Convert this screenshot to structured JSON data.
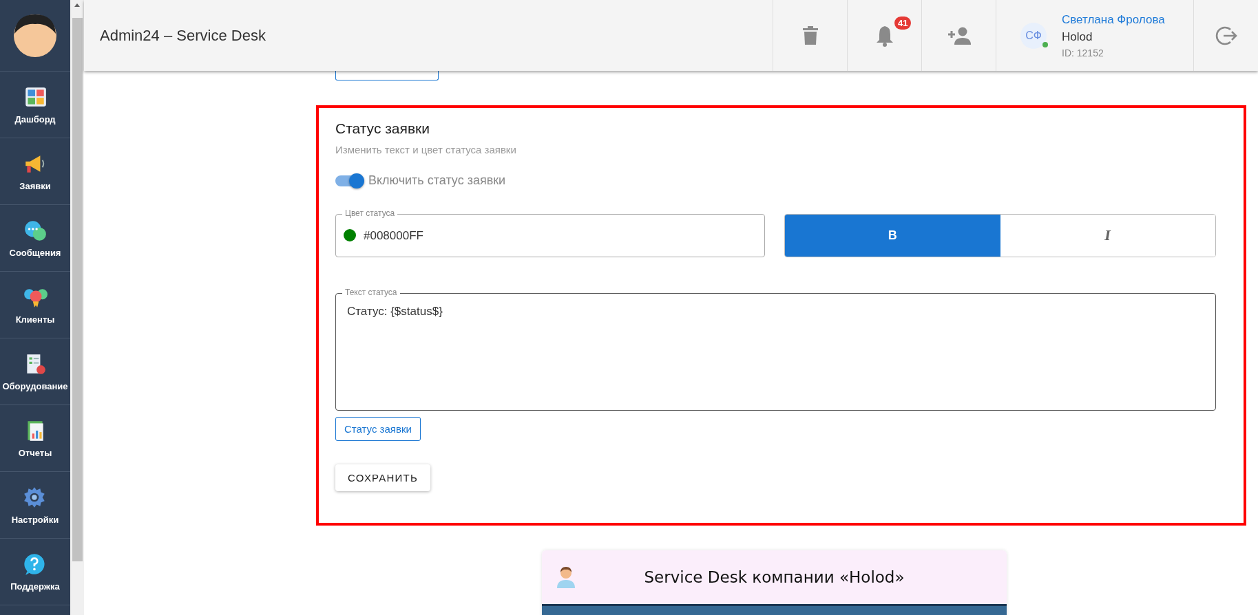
{
  "sidebar": {
    "items": [
      {
        "label": "Дашборд"
      },
      {
        "label": "Заявки"
      },
      {
        "label": "Сообщения"
      },
      {
        "label": "Клиенты"
      },
      {
        "label": "Оборудование"
      },
      {
        "label": "Отчеты"
      },
      {
        "label": "Настройки"
      },
      {
        "label": "Поддержка"
      }
    ]
  },
  "header": {
    "title": "Admin24 – Service Desk",
    "notifications": "41",
    "user": {
      "initials": "СФ",
      "name": "Светлана Фролова",
      "company": "Holod",
      "id": "ID: 12152",
      "online": true
    }
  },
  "status_section": {
    "title": "Статус заявки",
    "subtitle": "Изменить текст и цвет статуса заявки",
    "toggle": {
      "label": "Включить статус заявки",
      "on": true
    },
    "color_field": {
      "label": "Цвет статуса",
      "value": "#008000FF",
      "color": "#008000"
    },
    "style_buttons": [
      {
        "label": "B",
        "kind": "bold",
        "selected": true
      },
      {
        "label": "I",
        "kind": "italic",
        "selected": false
      }
    ],
    "text_field": {
      "label": "Текст статуса",
      "value": "Статус: {$status$}"
    },
    "insert_button": "Статус заявки",
    "save_button": "СОХРАНИТЬ"
  },
  "preview": {
    "title": "Service Desk компании «Holod»"
  }
}
